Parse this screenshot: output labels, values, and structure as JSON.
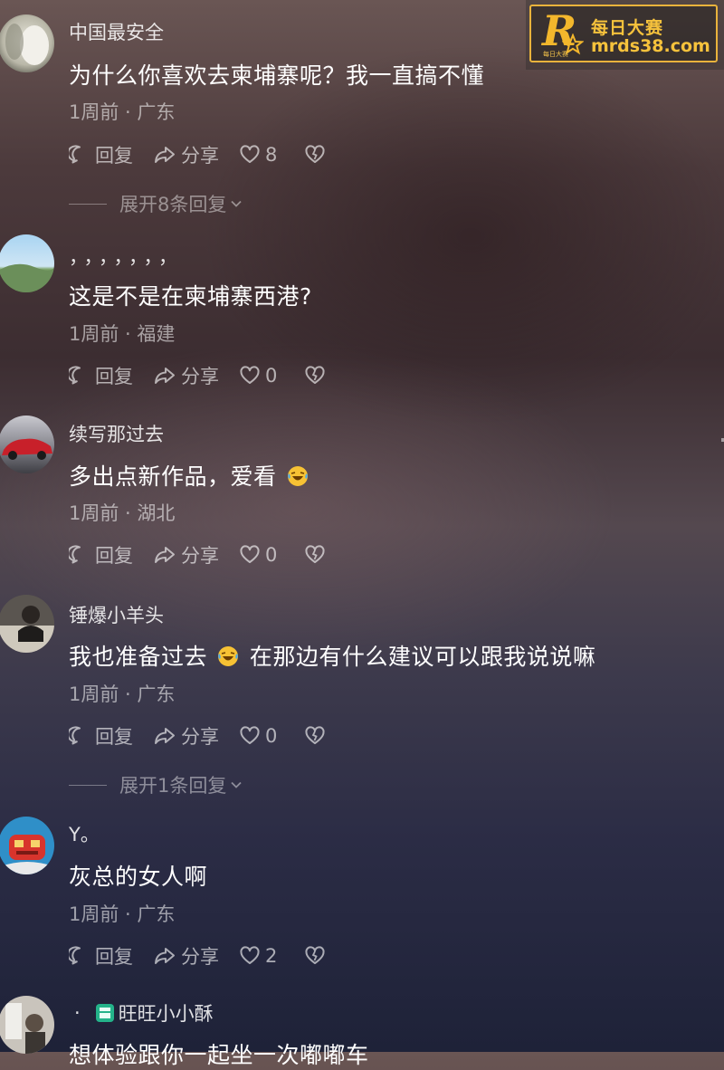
{
  "watermark": {
    "title": "每日大赛",
    "url": "mrds38.com",
    "badge_letter": "R",
    "badge_small": "每日大赛",
    "accent_color": "#f3b72c"
  },
  "actions": {
    "reply_label": "回复",
    "share_label": "分享"
  },
  "comments": [
    {
      "username": "中国最安全",
      "content": "为什么你喜欢去柬埔寨呢？我一直搞不懂",
      "meta": "1周前 · 广东",
      "likes": "8",
      "replies_label": "展开8条回复"
    },
    {
      "username": "，，，，，，，",
      "content": "这是不是在柬埔寨西港?",
      "meta": "1周前 · 福建",
      "likes": "0"
    },
    {
      "username": "续写那过去",
      "content": "多出点新作品，爱看",
      "emoji": "laugh-cry-emoji",
      "meta": "1周前 · 湖北",
      "likes": "0"
    },
    {
      "username": "锤爆小羊头",
      "content_before": "我也准备过去",
      "emoji": "laugh-cry-emoji",
      "content_after": "在那边有什么建议可以跟我说说嘛",
      "meta": "1周前 · 广东",
      "likes": "0",
      "replies_label": "展开1条回复"
    },
    {
      "username": "Y。",
      "content": "灰总的女人啊",
      "meta": "1周前 · 广东",
      "likes": "2"
    },
    {
      "username_prefix": "·",
      "username": "旺旺小小酥",
      "content": "想体验跟你一起坐一次嘟嘟车"
    }
  ]
}
